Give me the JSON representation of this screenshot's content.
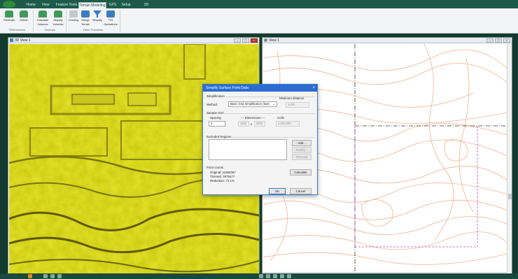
{
  "tabs": [
    {
      "label": "Home",
      "active": false
    },
    {
      "label": "View",
      "active": false
    },
    {
      "label": "Feature Tools",
      "active": false
    },
    {
      "label": "Terrain Modeling",
      "active": true
    },
    {
      "label": "GPS",
      "active": false
    },
    {
      "label": "Setup",
      "active": false
    },
    {
      "label": "3D",
      "active": false
    }
  ],
  "ribbon": {
    "buttons": {
      "generate": "Generate",
      "delete": "Delete",
      "calc_volumes": "Calculate Volumes",
      "display_volumes": "Display Volumes",
      "grading": "Grading",
      "merge_terrain": "Merge Terrain",
      "simplify": "Simplify",
      "tin_operations": "TIN Operations"
    },
    "groups": {
      "tin_contours": "TIN/Contours",
      "volumes": "Volumes",
      "other_functions": "Other Functions"
    }
  },
  "view3d": {
    "title": "3D View 1"
  },
  "view2d": {
    "title": "View 1"
  },
  "dialog": {
    "title": "Simplify Surface Point Data",
    "simplification_label": "Simplification",
    "method_label": "Method:",
    "method_value": "Basic Grid Simplification (fast)",
    "min_distance_label": "Minimum distance",
    "min_distance_value": "2.000",
    "sample_grid_label": "Sample Grid",
    "spacing_label": "Spacing",
    "spacing_value": "2",
    "dimensions_label": "--- Dimensions ---",
    "dim_x": "1500",
    "dim_sep": "x",
    "dim_y": "3000",
    "cells_label": "Cells",
    "cells_value": "4,500,000",
    "excluded_label": "Excluded Regions",
    "add_button": "Add...",
    "modify_button": "Modify...",
    "remove_button": "Remove",
    "point_counts_label": "Point counts",
    "original": "Original: 11864067",
    "thinned": "Thinned: 3075477",
    "reduction": "Reduction: 74.1%",
    "calculate_button": "Calculate",
    "ok_button": "OK",
    "cancel_button": "Cancel"
  },
  "colors": {
    "terrain": "#e3e02a",
    "contours": "#f2b28e",
    "accent": "#2b6cd1"
  }
}
